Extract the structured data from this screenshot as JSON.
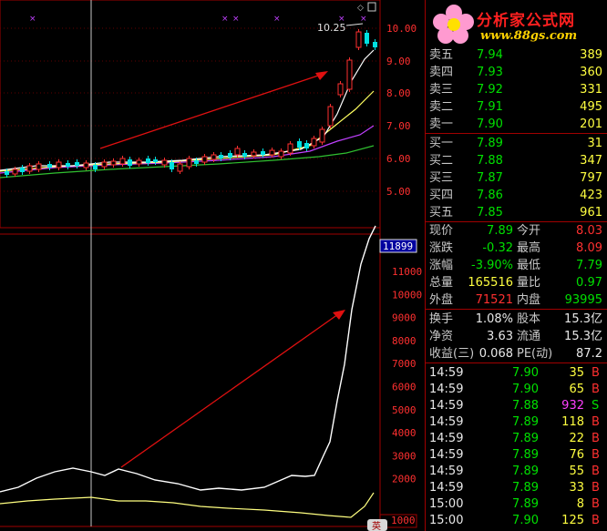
{
  "logo": {
    "title": "分析家公式网",
    "url": "www.88gs.com"
  },
  "chart": {
    "price_axis": [
      "10.00",
      "9.00",
      "8.00",
      "7.00",
      "6.00",
      "5.00"
    ],
    "peak_label": "10.25",
    "volume_axis": [
      "11000",
      "10000",
      "9000",
      "8000",
      "7000",
      "6000",
      "5000",
      "4000",
      "3000",
      "2000"
    ],
    "volume_current": "11899",
    "volume_bottom": "1000",
    "bottom_tag": "英"
  },
  "orderbook": {
    "asks": [
      {
        "label": "卖五",
        "price": "7.94",
        "vol": "389"
      },
      {
        "label": "卖四",
        "price": "7.93",
        "vol": "360"
      },
      {
        "label": "卖三",
        "price": "7.92",
        "vol": "331"
      },
      {
        "label": "卖二",
        "price": "7.91",
        "vol": "495"
      },
      {
        "label": "卖一",
        "price": "7.90",
        "vol": "201"
      }
    ],
    "bids": [
      {
        "label": "买一",
        "price": "7.89",
        "vol": "31"
      },
      {
        "label": "买二",
        "price": "7.88",
        "vol": "347"
      },
      {
        "label": "买三",
        "price": "7.87",
        "vol": "797"
      },
      {
        "label": "买四",
        "price": "7.86",
        "vol": "423"
      },
      {
        "label": "买五",
        "price": "7.85",
        "vol": "961"
      }
    ]
  },
  "quote": {
    "rows": [
      {
        "l1": "现价",
        "v1": "7.89",
        "c1": "green",
        "l2": "今开",
        "v2": "8.03",
        "c2": "red"
      },
      {
        "l1": "涨跌",
        "v1": "-0.32",
        "c1": "green",
        "l2": "最高",
        "v2": "8.09",
        "c2": "red"
      },
      {
        "l1": "涨幅",
        "v1": "-3.90%",
        "c1": "green",
        "l2": "最低",
        "v2": "7.79",
        "c2": "green"
      },
      {
        "l1": "总量",
        "v1": "165516",
        "c1": "yellow",
        "l2": "量比",
        "v2": "0.97",
        "c2": "green"
      },
      {
        "l1": "外盘",
        "v1": "71521",
        "c1": "red",
        "l2": "内盘",
        "v2": "93995",
        "c2": "green"
      }
    ]
  },
  "fundamentals": {
    "rows": [
      {
        "l1": "换手",
        "v1": "1.08%",
        "l2": "股本",
        "v2": "15.3亿"
      },
      {
        "l1": "净资",
        "v1": "3.63",
        "l2": "流通",
        "v2": "15.3亿"
      },
      {
        "l1": "收益(三)",
        "v1": "0.068",
        "l2": "PE(动)",
        "v2": "87.2"
      }
    ]
  },
  "ticks": [
    {
      "time": "14:59",
      "price": "7.90",
      "vol": "35",
      "vcolor": "yellow",
      "side": "B",
      "scolor": "red"
    },
    {
      "time": "14:59",
      "price": "7.90",
      "vol": "65",
      "vcolor": "yellow",
      "side": "B",
      "scolor": "red"
    },
    {
      "time": "14:59",
      "price": "7.88",
      "vol": "932",
      "vcolor": "magenta",
      "side": "S",
      "scolor": "green"
    },
    {
      "time": "14:59",
      "price": "7.89",
      "vol": "118",
      "vcolor": "yellow",
      "side": "B",
      "scolor": "red"
    },
    {
      "time": "14:59",
      "price": "7.89",
      "vol": "22",
      "vcolor": "yellow",
      "side": "B",
      "scolor": "red"
    },
    {
      "time": "14:59",
      "price": "7.89",
      "vol": "76",
      "vcolor": "yellow",
      "side": "B",
      "scolor": "red"
    },
    {
      "time": "14:59",
      "price": "7.89",
      "vol": "55",
      "vcolor": "yellow",
      "side": "B",
      "scolor": "red"
    },
    {
      "time": "14:59",
      "price": "7.89",
      "vol": "33",
      "vcolor": "yellow",
      "side": "B",
      "scolor": "red"
    },
    {
      "time": "15:00",
      "price": "7.89",
      "vol": "8",
      "vcolor": "yellow",
      "side": "B",
      "scolor": "red"
    },
    {
      "time": "15:00",
      "price": "7.90",
      "vol": "125",
      "vcolor": "yellow",
      "side": "B",
      "scolor": "red"
    }
  ],
  "colors": {
    "background": "#000000",
    "frame": "#a00000",
    "up": "#ff3030",
    "down": "#00e0e0",
    "arrow": "#e01010",
    "ma_white": "#ffffff",
    "ma_yellow": "#ffff60",
    "ma_purple": "#c040ff",
    "ma_green": "#30c030"
  }
}
